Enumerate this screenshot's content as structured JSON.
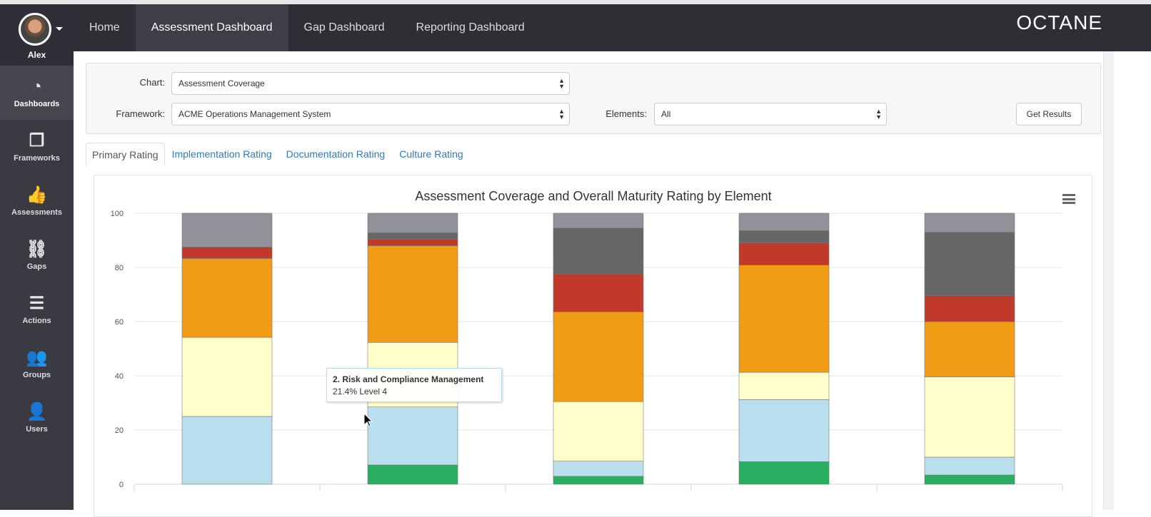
{
  "user": {
    "name": "Alex"
  },
  "sidebar": {
    "items": [
      {
        "label": "Dashboards",
        "icon": "pie-chart-icon",
        "glyph": "◔",
        "active": true
      },
      {
        "label": "Frameworks",
        "icon": "cubes-icon",
        "glyph": "❒"
      },
      {
        "label": "Assessments",
        "icon": "thumbs-up-icon",
        "glyph": "👍"
      },
      {
        "label": "Gaps",
        "icon": "broken-link-icon",
        "glyph": "⛓"
      },
      {
        "label": "Actions",
        "icon": "server-icon",
        "glyph": "☰"
      },
      {
        "label": "Groups",
        "icon": "users-group-icon",
        "glyph": "👥"
      },
      {
        "label": "Users",
        "icon": "user-icon",
        "glyph": "👤"
      }
    ]
  },
  "nav": {
    "items": [
      "Home",
      "Assessment Dashboard",
      "Gap Dashboard",
      "Reporting Dashboard"
    ],
    "active": 1,
    "logo": "OCTANE"
  },
  "filters": {
    "chart_label": "Chart:",
    "chart_value": "Assessment Coverage",
    "framework_label": "Framework:",
    "framework_value": "ACME Operations Management System",
    "elements_label": "Elements:",
    "elements_value": "All",
    "get_results": "Get Results"
  },
  "tabs": [
    "Primary Rating",
    "Implementation Rating",
    "Documentation Rating",
    "Culture Rating"
  ],
  "tooltip": {
    "title": "2. Risk and Compliance Management",
    "text": "21.4% Level 4"
  },
  "chart_data": {
    "type": "bar",
    "stacked": true,
    "title": "Assessment Coverage and Overall Maturity Rating by Element",
    "xlabel": "",
    "ylabel": "",
    "ylim": [
      0,
      100
    ],
    "yticks": [
      0,
      20,
      40,
      60,
      80,
      100
    ],
    "grid": true,
    "categories": [
      "",
      "",
      "",
      "",
      ""
    ],
    "series": [
      {
        "color": "#27ae60",
        "values": [
          0,
          7.1,
          2.9,
          8.3,
          3.4
        ]
      },
      {
        "name": "Level 4",
        "color": "#b9dfee",
        "values": [
          25.0,
          21.4,
          5.6,
          22.9,
          6.6
        ]
      },
      {
        "color": "#ffffcc",
        "values": [
          29.2,
          23.8,
          22.0,
          10.1,
          29.6
        ]
      },
      {
        "color": "#f09c14",
        "values": [
          29.1,
          35.7,
          33.1,
          39.6,
          20.4
        ]
      },
      {
        "color": "#c0392b",
        "values": [
          4.2,
          2.4,
          14.0,
          8.2,
          9.6
        ]
      },
      {
        "color": "#666666",
        "values": [
          0,
          2.4,
          16.9,
          4.5,
          23.4
        ]
      },
      {
        "color": "#919199",
        "values": [
          12.5,
          7.2,
          5.5,
          6.4,
          7.0
        ]
      }
    ]
  }
}
